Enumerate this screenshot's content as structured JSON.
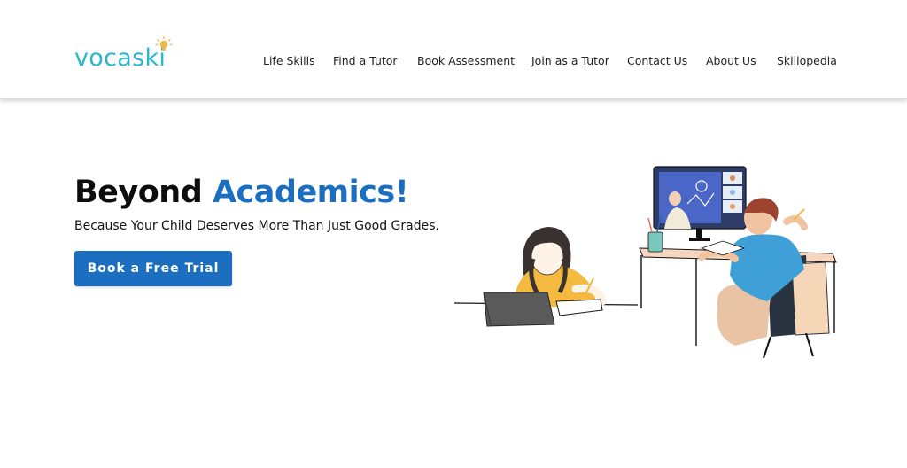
{
  "brand": {
    "name": "vocaski",
    "logo_color": "#2bb6cc",
    "bulb_icon": "lightbulb-icon"
  },
  "nav": {
    "items": [
      {
        "label": "Life Skills"
      },
      {
        "label": "Find a Tutor"
      },
      {
        "label": "Book Assessment"
      },
      {
        "label": "Join as a Tutor"
      },
      {
        "label": "Contact Us"
      },
      {
        "label": "About Us"
      },
      {
        "label": "Skillopedia"
      }
    ]
  },
  "hero": {
    "title_part1": "Beyond",
    "title_part2": "Academics!",
    "subtitle": "Because Your Child Deserves More Than Just Good Grades.",
    "cta_label": "Book a Free Trial",
    "accent_color": "#1c6fc0",
    "illustration": "online-learning-illustration"
  }
}
